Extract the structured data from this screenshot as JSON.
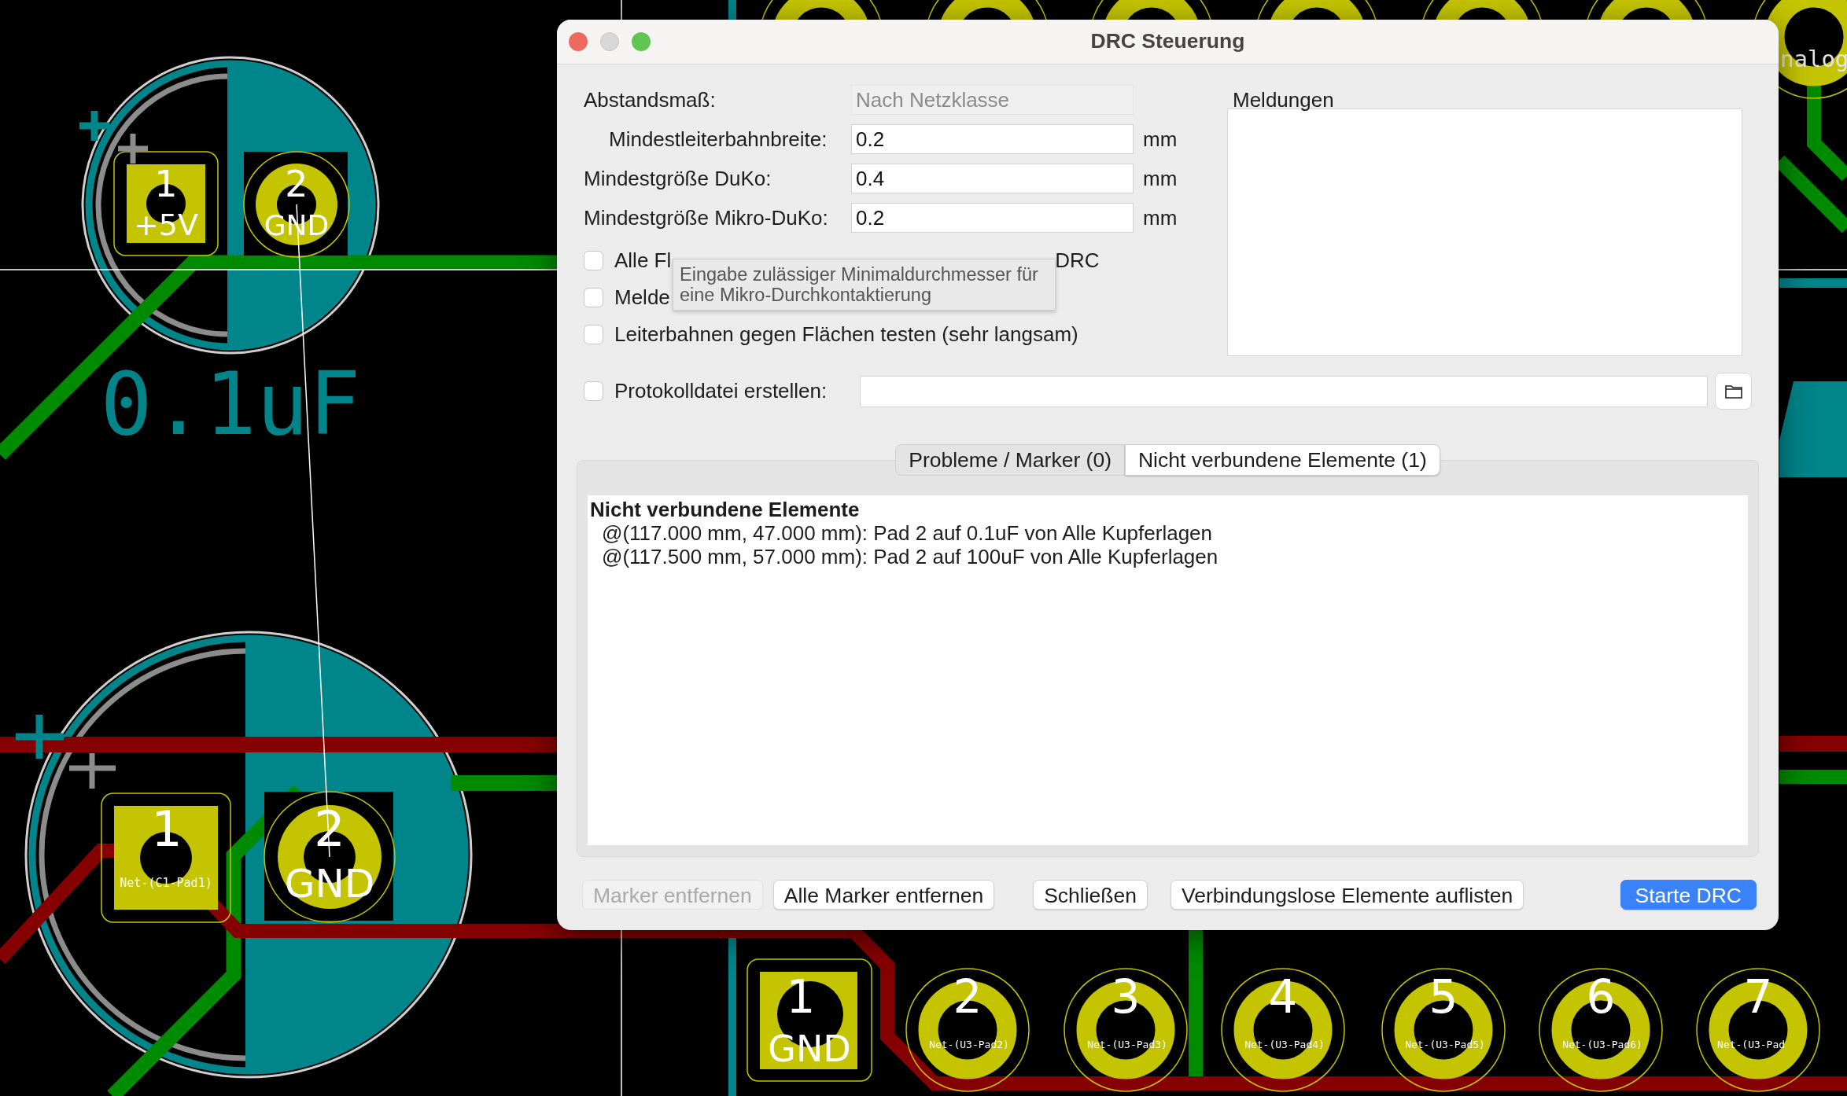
{
  "window": {
    "title": "DRC Steuerung",
    "controls": [
      {
        "kind": "close",
        "disabled": false
      },
      {
        "kind": "minimize",
        "disabled": true
      },
      {
        "kind": "zoom",
        "disabled": false
      }
    ]
  },
  "clearance": {
    "label": "Abstandsmaß:",
    "value": "Nach Netzklasse",
    "disabled": true
  },
  "fields": [
    {
      "label": "Mindestleiterbahnbreite:",
      "value": "0.2",
      "unit": "mm",
      "indented": true
    },
    {
      "label": "Mindestgröße DuKo:",
      "value": "0.4",
      "unit": "mm",
      "indented": false
    },
    {
      "label": "Mindestgröße Mikro-DuKo:",
      "value": "0.2",
      "unit": "mm",
      "indented": false
    }
  ],
  "options": [
    {
      "label": "Alle Fl",
      "label_end": "DRC",
      "checked": false
    },
    {
      "label": "Melde",
      "checked": false
    },
    {
      "label": "Leiterbahnen gegen Flächen testen (sehr langsam)",
      "checked": false
    }
  ],
  "tooltip": "Eingabe zulässiger Minimaldurchmesser für\neine Mikro-Durchkontaktierung",
  "log_file": {
    "label": "Protokolldatei erstellen:",
    "checked": false
  },
  "messages": {
    "label": "Meldungen"
  },
  "tabs": [
    {
      "label": "Probleme / Marker (0)",
      "selected": false
    },
    {
      "label": "Nicht verbundene Elemente (1)",
      "selected": true
    }
  ],
  "report": {
    "heading": "Nicht verbundene Elemente",
    "items": [
      "@(117.000 mm, 47.000 mm): Pad 2 auf 0.1uF von Alle Kupferlagen",
      "@(117.500 mm, 57.000 mm): Pad 2 auf 100uF von Alle Kupferlagen"
    ]
  },
  "buttons": [
    {
      "label": "Marker entfernen",
      "kind": "default",
      "disabled": true
    },
    {
      "label": "Alle Marker entfernen",
      "kind": "default",
      "disabled": false
    },
    {
      "label": "Schließen",
      "kind": "default",
      "disabled": false
    },
    {
      "label": "Verbindungslose Elemente auflisten",
      "kind": "default",
      "disabled": false
    },
    {
      "label": "Starte DRC",
      "kind": "primary",
      "disabled": false
    }
  ],
  "board": {
    "components": [
      {
        "value": "0.1uF",
        "pads": [
          {
            "number": "1",
            "net": "+5V",
            "kind": "square"
          },
          {
            "number": "2",
            "net": "GND",
            "kind": "round"
          }
        ]
      },
      {
        "pads": [
          {
            "number": "1",
            "net": "Net-(C1-Pad1)",
            "kind": "square"
          },
          {
            "number": "2",
            "net": "GND",
            "kind": "round"
          }
        ]
      }
    ],
    "header": {
      "pads": [
        {
          "number": "1",
          "net": "GND",
          "kind": "square"
        },
        {
          "number": "2",
          "net": "Net-(U3-Pad2)",
          "kind": "round"
        },
        {
          "number": "3",
          "net": "Net-(U3-Pad3)",
          "kind": "round"
        },
        {
          "number": "4",
          "net": "Net-(U3-Pad4)",
          "kind": "round"
        },
        {
          "number": "5",
          "net": "Net-(U3-Pad5)",
          "kind": "round"
        },
        {
          "number": "6",
          "net": "Net-(U3-Pad6)",
          "kind": "round"
        },
        {
          "number": "7",
          "net": "Net-(U3-Pad",
          "kind": "round"
        }
      ]
    },
    "labels": [
      "nalog"
    ]
  }
}
